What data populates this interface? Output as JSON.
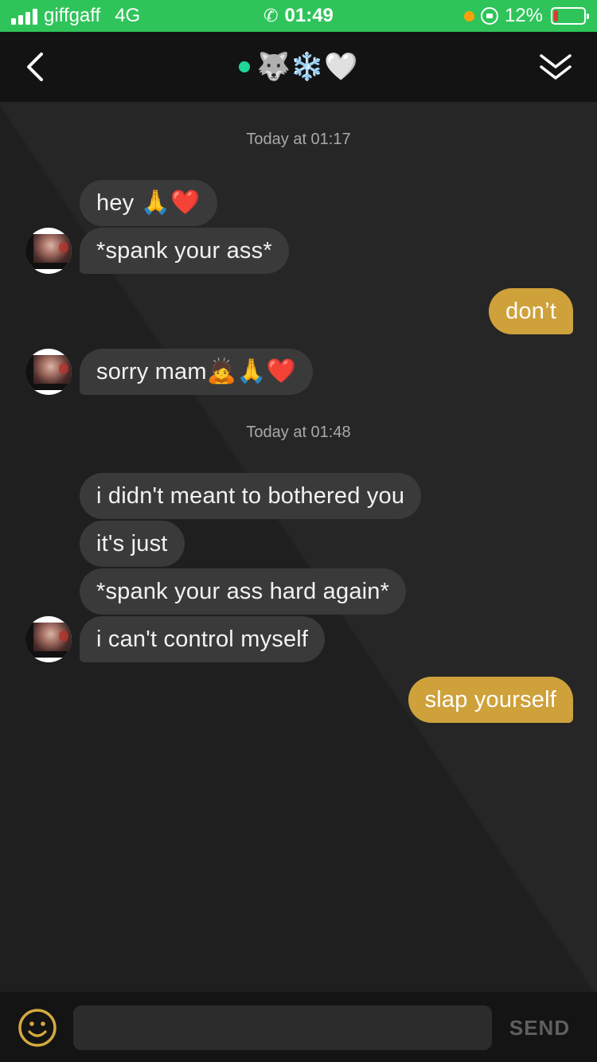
{
  "status_bar": {
    "carrier": "giffgaff",
    "network": "4G",
    "time": "01:49",
    "battery": "12%"
  },
  "header": {
    "title_emoji": "🐺❄️🤍",
    "online_color": "#1ed79a"
  },
  "conversation": {
    "timestamps": [
      "Today at 01:17",
      "Today at 01:48"
    ],
    "messages": [
      {
        "from": "them",
        "text": "hey ",
        "emoji": "🙏❤️"
      },
      {
        "from": "them",
        "text": "*spank your ass*"
      },
      {
        "from": "me",
        "text": "don’t"
      },
      {
        "from": "them",
        "text": "sorry mam",
        "emoji": "🙇🙏❤️"
      },
      {
        "from": "them",
        "text": "i didn't meant to bothered you"
      },
      {
        "from": "them",
        "text": "it's just"
      },
      {
        "from": "them",
        "text": "*spank your ass hard again*"
      },
      {
        "from": "them",
        "text": "i can't control myself"
      },
      {
        "from": "me",
        "text": "slap yourself"
      }
    ]
  },
  "input": {
    "placeholder": "",
    "send_label": "SEND"
  },
  "colors": {
    "status_green": "#2fc45a",
    "outgoing_bubble": "#cfa13b",
    "incoming_bubble": "#3a3a3a"
  },
  "icons": [
    "signal-icon",
    "phone-icon",
    "rotation-lock-icon",
    "battery-icon",
    "back-arrow-icon",
    "double-chevron-down-icon",
    "smiley-icon"
  ]
}
